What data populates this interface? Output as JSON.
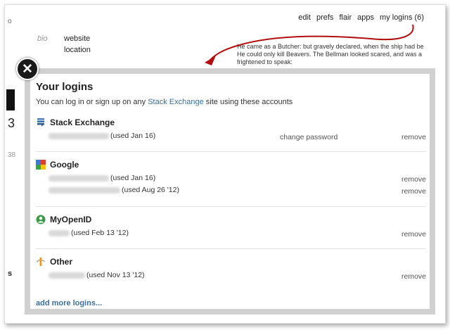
{
  "topnav": [
    "edit",
    "prefs",
    "flair",
    "apps",
    "my logins (6)"
  ],
  "background": {
    "corner": "o",
    "bio_label": "bio",
    "website_label": "website",
    "location_label": "location",
    "quote_lines": [
      "He came as a Butcher: but gravely declared, when the ship had be",
      "He could only kill Beavers. The Bellman looked scared, and was a",
      "frightened to speak:"
    ],
    "edge_chars": [
      "3",
      "38",
      "s"
    ]
  },
  "modal": {
    "title": "Your logins",
    "subtitle_prefix": "You can log in or sign up on any ",
    "subtitle_link": "Stack Exchange",
    "subtitle_suffix": " site using these accounts",
    "sections": [
      {
        "name": "Stack Exchange",
        "icon": "stackexchange-icon",
        "rows": [
          {
            "used": "(used Jan 16)",
            "change_password": "change password",
            "remove": "remove"
          }
        ]
      },
      {
        "name": "Google",
        "icon": "google-icon",
        "rows": [
          {
            "used": "(used Jan 16)",
            "remove": "remove"
          },
          {
            "used": "(used Aug 26 '12)",
            "remove": "remove"
          }
        ]
      },
      {
        "name": "MyOpenID",
        "icon": "myopenid-icon",
        "rows": [
          {
            "used": "(used Feb 13 '12)",
            "remove": "remove"
          }
        ]
      },
      {
        "name": "Other",
        "icon": "openid-icon",
        "rows": [
          {
            "used": "(used Nov 13 '12)",
            "remove": "remove"
          }
        ]
      }
    ],
    "add_more": "add more logins..."
  },
  "colors": {
    "link": "#3b6f99",
    "arrow": "#b01010",
    "modal_border": "#d0d0d0"
  }
}
